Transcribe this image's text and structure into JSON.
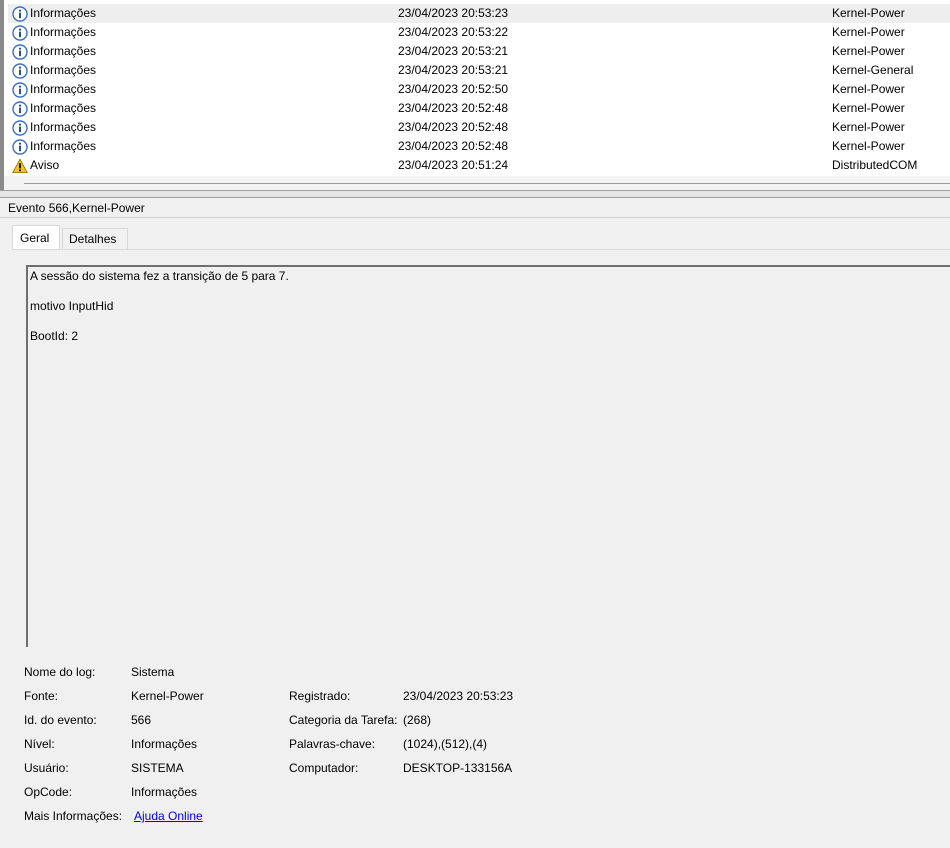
{
  "events": [
    {
      "level": "Informações",
      "icon": "info-icon",
      "datetime": "23/04/2023 20:53:23",
      "source": "Kernel-Power",
      "selected": true
    },
    {
      "level": "Informações",
      "icon": "info-icon",
      "datetime": "23/04/2023 20:53:22",
      "source": "Kernel-Power"
    },
    {
      "level": "Informações",
      "icon": "info-icon",
      "datetime": "23/04/2023 20:53:21",
      "source": "Kernel-Power"
    },
    {
      "level": "Informações",
      "icon": "info-icon",
      "datetime": "23/04/2023 20:53:21",
      "source": "Kernel-General"
    },
    {
      "level": "Informações",
      "icon": "info-icon",
      "datetime": "23/04/2023 20:52:50",
      "source": "Kernel-Power"
    },
    {
      "level": "Informações",
      "icon": "info-icon",
      "datetime": "23/04/2023 20:52:48",
      "source": "Kernel-Power"
    },
    {
      "level": "Informações",
      "icon": "info-icon",
      "datetime": "23/04/2023 20:52:48",
      "source": "Kernel-Power"
    },
    {
      "level": "Informações",
      "icon": "info-icon",
      "datetime": "23/04/2023 20:52:48",
      "source": "Kernel-Power"
    },
    {
      "level": "Aviso",
      "icon": "warning-icon",
      "datetime": "23/04/2023 20:51:24",
      "source": "DistributedCOM"
    }
  ],
  "detail": {
    "header": "Evento 566,Kernel-Power",
    "tabs": {
      "general": "Geral",
      "details": "Detalhes"
    },
    "description": [
      "A sessão do sistema fez a transição de 5 para 7.",
      "motivo InputHid",
      "BootId: 2"
    ],
    "properties": {
      "log_name_label": "Nome do log:",
      "log_name": "Sistema",
      "source_label": "Fonte:",
      "source": "Kernel-Power",
      "logged_label": "Registrado:",
      "logged": "23/04/2023 20:53:23",
      "event_id_label": "Id. do evento:",
      "event_id": "566",
      "task_category_label": "Categoria da Tarefa:",
      "task_category": "(268)",
      "level_label": "Nível:",
      "level": "Informações",
      "keywords_label": "Palavras-chave:",
      "keywords": "(1024),(512),(4)",
      "user_label": "Usuário:",
      "user": "SISTEMA",
      "computer_label": "Computador:",
      "computer": "DESKTOP-133156A",
      "opcode_label": "OpCode:",
      "opcode": "Informações",
      "more_info_label": "Mais Informações:",
      "more_info_link": "Ajuda Online"
    }
  },
  "colors": {
    "info": "#3b6fc4",
    "warning": "#f5c518",
    "link": "#0000ee"
  }
}
